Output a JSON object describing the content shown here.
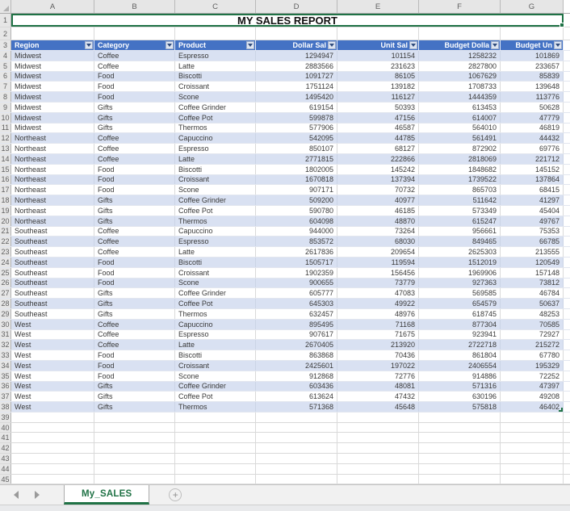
{
  "title": "MY SALES REPORT",
  "grid": {
    "column_letters": [
      "A",
      "B",
      "C",
      "D",
      "E",
      "F",
      "G"
    ],
    "row_count": 45
  },
  "table": {
    "headers": [
      "Region",
      "Category",
      "Product",
      "Dollar Sal",
      "Unit Sal",
      "Budget Dolla",
      "Budget Un"
    ],
    "rows": [
      [
        "Midwest",
        "Coffee",
        "Espresso",
        "1294947",
        "101154",
        "1258232",
        "101869"
      ],
      [
        "Midwest",
        "Coffee",
        "Latte",
        "2883566",
        "231623",
        "2827800",
        "233657"
      ],
      [
        "Midwest",
        "Food",
        "Biscotti",
        "1091727",
        "86105",
        "1067629",
        "85839"
      ],
      [
        "Midwest",
        "Food",
        "Croissant",
        "1751124",
        "139182",
        "1708733",
        "139648"
      ],
      [
        "Midwest",
        "Food",
        "Scone",
        "1495420",
        "116127",
        "1444359",
        "113776"
      ],
      [
        "Midwest",
        "Gifts",
        "Coffee Grinder",
        "619154",
        "50393",
        "613453",
        "50628"
      ],
      [
        "Midwest",
        "Gifts",
        "Coffee Pot",
        "599878",
        "47156",
        "614007",
        "47779"
      ],
      [
        "Midwest",
        "Gifts",
        "Thermos",
        "577906",
        "46587",
        "564010",
        "46819"
      ],
      [
        "Northeast",
        "Coffee",
        "Capuccino",
        "542095",
        "44785",
        "561491",
        "44432"
      ],
      [
        "Northeast",
        "Coffee",
        "Espresso",
        "850107",
        "68127",
        "872902",
        "69776"
      ],
      [
        "Northeast",
        "Coffee",
        "Latte",
        "2771815",
        "222866",
        "2818069",
        "221712"
      ],
      [
        "Northeast",
        "Food",
        "Biscotti",
        "1802005",
        "145242",
        "1848682",
        "145152"
      ],
      [
        "Northeast",
        "Food",
        "Croissant",
        "1670818",
        "137394",
        "1739522",
        "137864"
      ],
      [
        "Northeast",
        "Food",
        "Scone",
        "907171",
        "70732",
        "865703",
        "68415"
      ],
      [
        "Northeast",
        "Gifts",
        "Coffee Grinder",
        "509200",
        "40977",
        "511642",
        "41297"
      ],
      [
        "Northeast",
        "Gifts",
        "Coffee Pot",
        "590780",
        "46185",
        "573349",
        "45404"
      ],
      [
        "Northeast",
        "Gifts",
        "Thermos",
        "604098",
        "48870",
        "615247",
        "49767"
      ],
      [
        "Southeast",
        "Coffee",
        "Capuccino",
        "944000",
        "73264",
        "956661",
        "75353"
      ],
      [
        "Southeast",
        "Coffee",
        "Espresso",
        "853572",
        "68030",
        "849465",
        "66785"
      ],
      [
        "Southeast",
        "Coffee",
        "Latte",
        "2617836",
        "209654",
        "2625303",
        "213555"
      ],
      [
        "Southeast",
        "Food",
        "Biscotti",
        "1505717",
        "119594",
        "1512019",
        "120549"
      ],
      [
        "Southeast",
        "Food",
        "Croissant",
        "1902359",
        "156456",
        "1969906",
        "157148"
      ],
      [
        "Southeast",
        "Food",
        "Scone",
        "900655",
        "73779",
        "927363",
        "73812"
      ],
      [
        "Southeast",
        "Gifts",
        "Coffee Grinder",
        "605777",
        "47083",
        "569585",
        "46784"
      ],
      [
        "Southeast",
        "Gifts",
        "Coffee Pot",
        "645303",
        "49922",
        "654579",
        "50637"
      ],
      [
        "Southeast",
        "Gifts",
        "Thermos",
        "632457",
        "48976",
        "618745",
        "48253"
      ],
      [
        "West",
        "Coffee",
        "Capuccino",
        "895495",
        "71168",
        "877304",
        "70585"
      ],
      [
        "West",
        "Coffee",
        "Espresso",
        "907617",
        "71675",
        "923941",
        "72927"
      ],
      [
        "West",
        "Coffee",
        "Latte",
        "2670405",
        "213920",
        "2722718",
        "215272"
      ],
      [
        "West",
        "Food",
        "Biscotti",
        "863868",
        "70436",
        "861804",
        "67780"
      ],
      [
        "West",
        "Food",
        "Croissant",
        "2425601",
        "197022",
        "2406554",
        "195329"
      ],
      [
        "West",
        "Food",
        "Scone",
        "912868",
        "72776",
        "914886",
        "72252"
      ],
      [
        "West",
        "Gifts",
        "Coffee Grinder",
        "603436",
        "48081",
        "571316",
        "47397"
      ],
      [
        "West",
        "Gifts",
        "Coffee Pot",
        "613624",
        "47432",
        "630196",
        "49208"
      ],
      [
        "West",
        "Gifts",
        "Thermos",
        "571368",
        "45648",
        "575818",
        "46402"
      ]
    ]
  },
  "sheet_tabs": {
    "active_label": "My_SALES",
    "add_sheet_glyph": "+"
  },
  "icons": {
    "filter_dropdown": "filter-dropdown-triangle",
    "prev_sheet": "left-triangle",
    "next_sheet": "right-triangle",
    "select_all": "corner-triangle"
  },
  "colors": {
    "table_header_bg": "#4472C4",
    "band_row_bg": "#D9E1F2",
    "selection_green": "#1F7245",
    "grid_line": "#D9D9D9",
    "header_strip_bg": "#E6E6E6"
  }
}
